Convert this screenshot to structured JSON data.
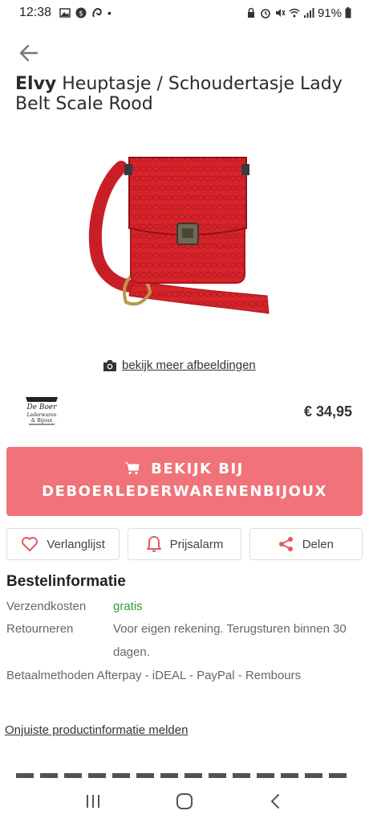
{
  "status_bar": {
    "time": "12:38",
    "battery": "91%"
  },
  "product": {
    "brand": "Elvy",
    "name": "Heuptasje / Schoudertasje Lady Belt Scale Rood",
    "more_images_label": "bekijk meer afbeeldingen",
    "price": "€ 34,95"
  },
  "shop": {
    "logo_text_1": "De Boer",
    "logo_text_2": "Lederwaren",
    "logo_text_3": "& Bijoux"
  },
  "cta": {
    "line1": "BEKIJK BIJ",
    "line2": "DEBOERLEDERWARENENBIJOUX"
  },
  "actions": {
    "wishlist": "Verlanglijst",
    "price_alert": "Prijsalarm",
    "share": "Delen"
  },
  "order_info": {
    "title": "Bestelinformatie",
    "shipping_label": "Verzendkosten",
    "shipping_value": "gratis",
    "returns_label": "Retourneren",
    "returns_value": "Voor eigen rekening. Terugsturen binnen 30 dagen.",
    "payment_label": "Betaalmethoden",
    "payment_value": "Afterpay - iDEAL - PayPal - Rembours"
  },
  "report_link": "Onjuiste productinformatie melden",
  "colors": {
    "cta": "#f07379",
    "free": "#2e9d3a",
    "bag": "#d8232a"
  }
}
